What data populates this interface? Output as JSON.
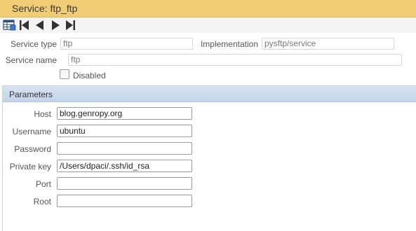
{
  "window": {
    "title": "Service: ftp_ftp"
  },
  "navbar": {
    "icons": [
      "table-list-icon",
      "first-record-icon",
      "previous-record-icon",
      "next-record-icon",
      "last-record-icon"
    ]
  },
  "form": {
    "service_type_label": "Service type",
    "service_type_value": "ftp",
    "implementation_label": "Implementation",
    "implementation_value": "pysftp/service",
    "service_name_label": "Service name",
    "service_name_value": "ftp",
    "disabled_label": "Disabled",
    "disabled_checked": false
  },
  "parameters": {
    "title": "Parameters",
    "fields": [
      {
        "label": "Host",
        "value": "blog.genropy.org"
      },
      {
        "label": "Username",
        "value": "ubuntu"
      },
      {
        "label": "Password",
        "value": ""
      },
      {
        "label": "Private key",
        "value": "/Users/dpaci/.ssh/id_rsa"
      },
      {
        "label": "Port",
        "value": ""
      },
      {
        "label": "Root",
        "value": ""
      }
    ]
  },
  "colors": {
    "title_bar": "#f0cd74",
    "panel_header": "#c9d8ec"
  }
}
